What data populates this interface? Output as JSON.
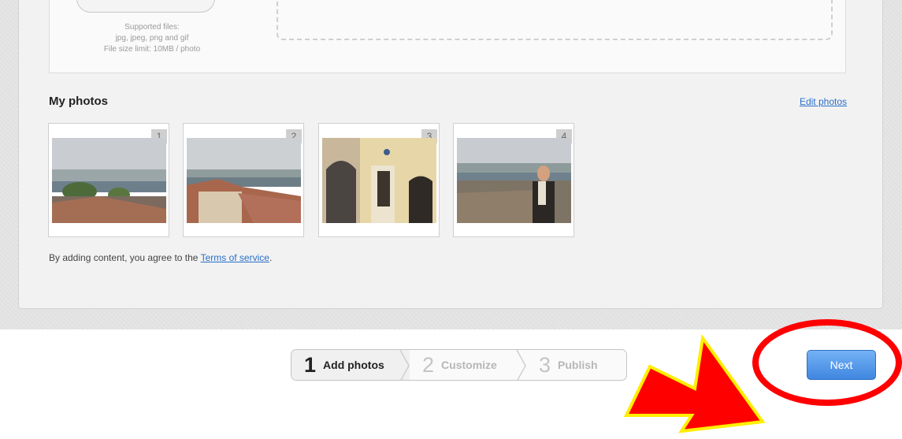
{
  "upload": {
    "supported_title": "Supported files:",
    "supported_types": "jpg, jpeg, png and gif",
    "size_limit": "File size limit: 10MB / photo"
  },
  "my_photos": {
    "title": "My photos",
    "edit_link": "Edit photos",
    "photos": [
      {
        "number": "1"
      },
      {
        "number": "2"
      },
      {
        "number": "3"
      },
      {
        "number": "4"
      }
    ]
  },
  "terms": {
    "prefix": "By adding content, you agree to the ",
    "link": "Terms of service",
    "suffix": "."
  },
  "steps": [
    {
      "number": "1",
      "label": "Add photos",
      "active": true
    },
    {
      "number": "2",
      "label": "Customize",
      "active": false
    },
    {
      "number": "3",
      "label": "Publish",
      "active": false
    }
  ],
  "next_button": {
    "label": "Next"
  },
  "colors": {
    "accent": "#3f86e0",
    "link": "#2a6fc9",
    "highlight_ring": "#ff0000",
    "arrow_fill": "#ff0000",
    "arrow_outline": "#ffee00"
  },
  "icons": {
    "annotation_arrow": "arrow-icon",
    "annotation_ring": "circle-highlight"
  }
}
